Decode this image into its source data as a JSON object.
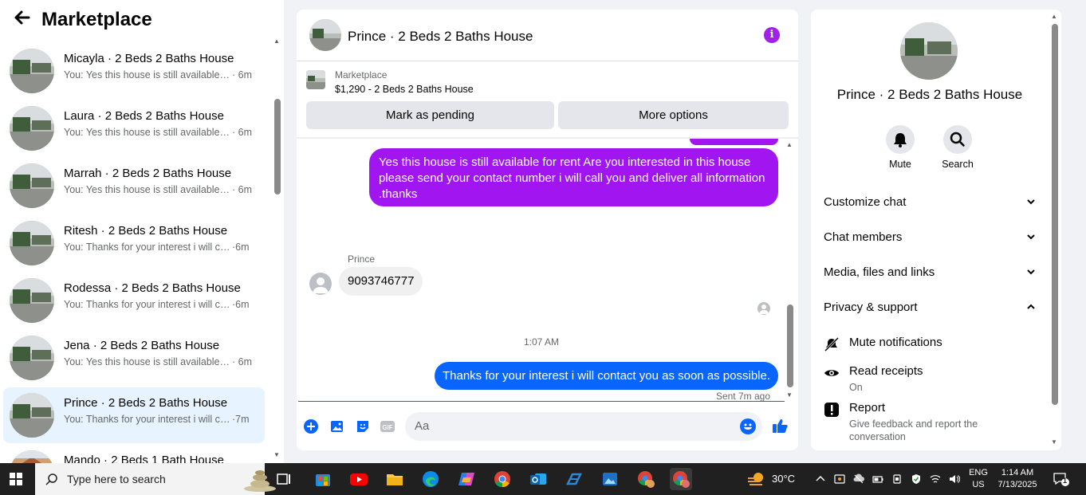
{
  "sidebar": {
    "back_icon": "arrow-left-icon",
    "title": "Marketplace",
    "conversations": [
      {
        "name": "Micayla · 2 Beds 2 Baths House",
        "preview": "You: Yes this house is still available for rent",
        "time": "· 6m",
        "active": false
      },
      {
        "name": "Laura · 2 Beds 2 Baths House",
        "preview": "You: Yes this house is still available for rent",
        "time": "· 6m",
        "active": false
      },
      {
        "name": "Marrah · 2 Beds 2 Baths House",
        "preview": "You: Yes this house is still available for rent",
        "time": "· 6m",
        "active": false
      },
      {
        "name": "Ritesh · 2 Beds 2 Baths House",
        "preview": "You: Thanks for your interest i will contact you",
        "time": "·6m",
        "active": false
      },
      {
        "name": "Rodessa · 2 Beds 2 Baths House",
        "preview": "You: Thanks for your interest i will contact you",
        "time": "·6m",
        "active": false
      },
      {
        "name": "Jena · 2 Beds 2 Baths House",
        "preview": "You: Yes this house is still available for rent",
        "time": "· 6m",
        "active": false
      },
      {
        "name": "Prince · 2 Beds 2 Baths House",
        "preview": "You: Thanks for your interest i will contact you",
        "time": "·7m",
        "active": true
      },
      {
        "name": "Mando · 2 Beds 1 Bath House",
        "preview": "",
        "time": "",
        "active": false
      }
    ]
  },
  "chat": {
    "header_name": "Prince · 2 Beds 2 Baths House",
    "info_icon": "info-icon",
    "marketplace_label": "Marketplace",
    "listing": "$1,290 - 2 Beds 2 Baths House",
    "mark_pending": "Mark as pending",
    "more_options": "More options",
    "messages": {
      "outgoing_1": "Yes this house is still available for rent  Are you interested in  this house please send your contact number i will call you and deliver all information .thanks",
      "sender_name": "Prince",
      "incoming_1": "9093746777",
      "timestamp": "1:07 AM",
      "outgoing_2": "Thanks for your interest i will contact you as soon as possible.",
      "sent_status": "Sent 7m ago"
    },
    "composer_placeholder": "Aa",
    "colors": {
      "outgoing_purple": "#a115f0",
      "outgoing_blue": "#0866ff",
      "accent": "#a121e9"
    }
  },
  "panel": {
    "name": "Prince · 2 Beds 2 Baths House",
    "mute_label": "Mute",
    "search_label": "Search",
    "sections": {
      "customize": "Customize chat",
      "members": "Chat members",
      "media": "Media, files and links",
      "privacy": "Privacy & support"
    },
    "privacy_items": {
      "mute_notifications": "Mute notifications",
      "read_receipts": "Read receipts",
      "read_receipts_state": "On",
      "report": "Report",
      "report_desc": "Give feedback and report the conversation"
    }
  },
  "taskbar": {
    "search_placeholder": "Type here to search",
    "weather": "30°C",
    "lang_top": "ENG",
    "lang_bottom": "US",
    "time": "1:14 AM",
    "date": "7/13/2025",
    "notification_count": "1"
  }
}
